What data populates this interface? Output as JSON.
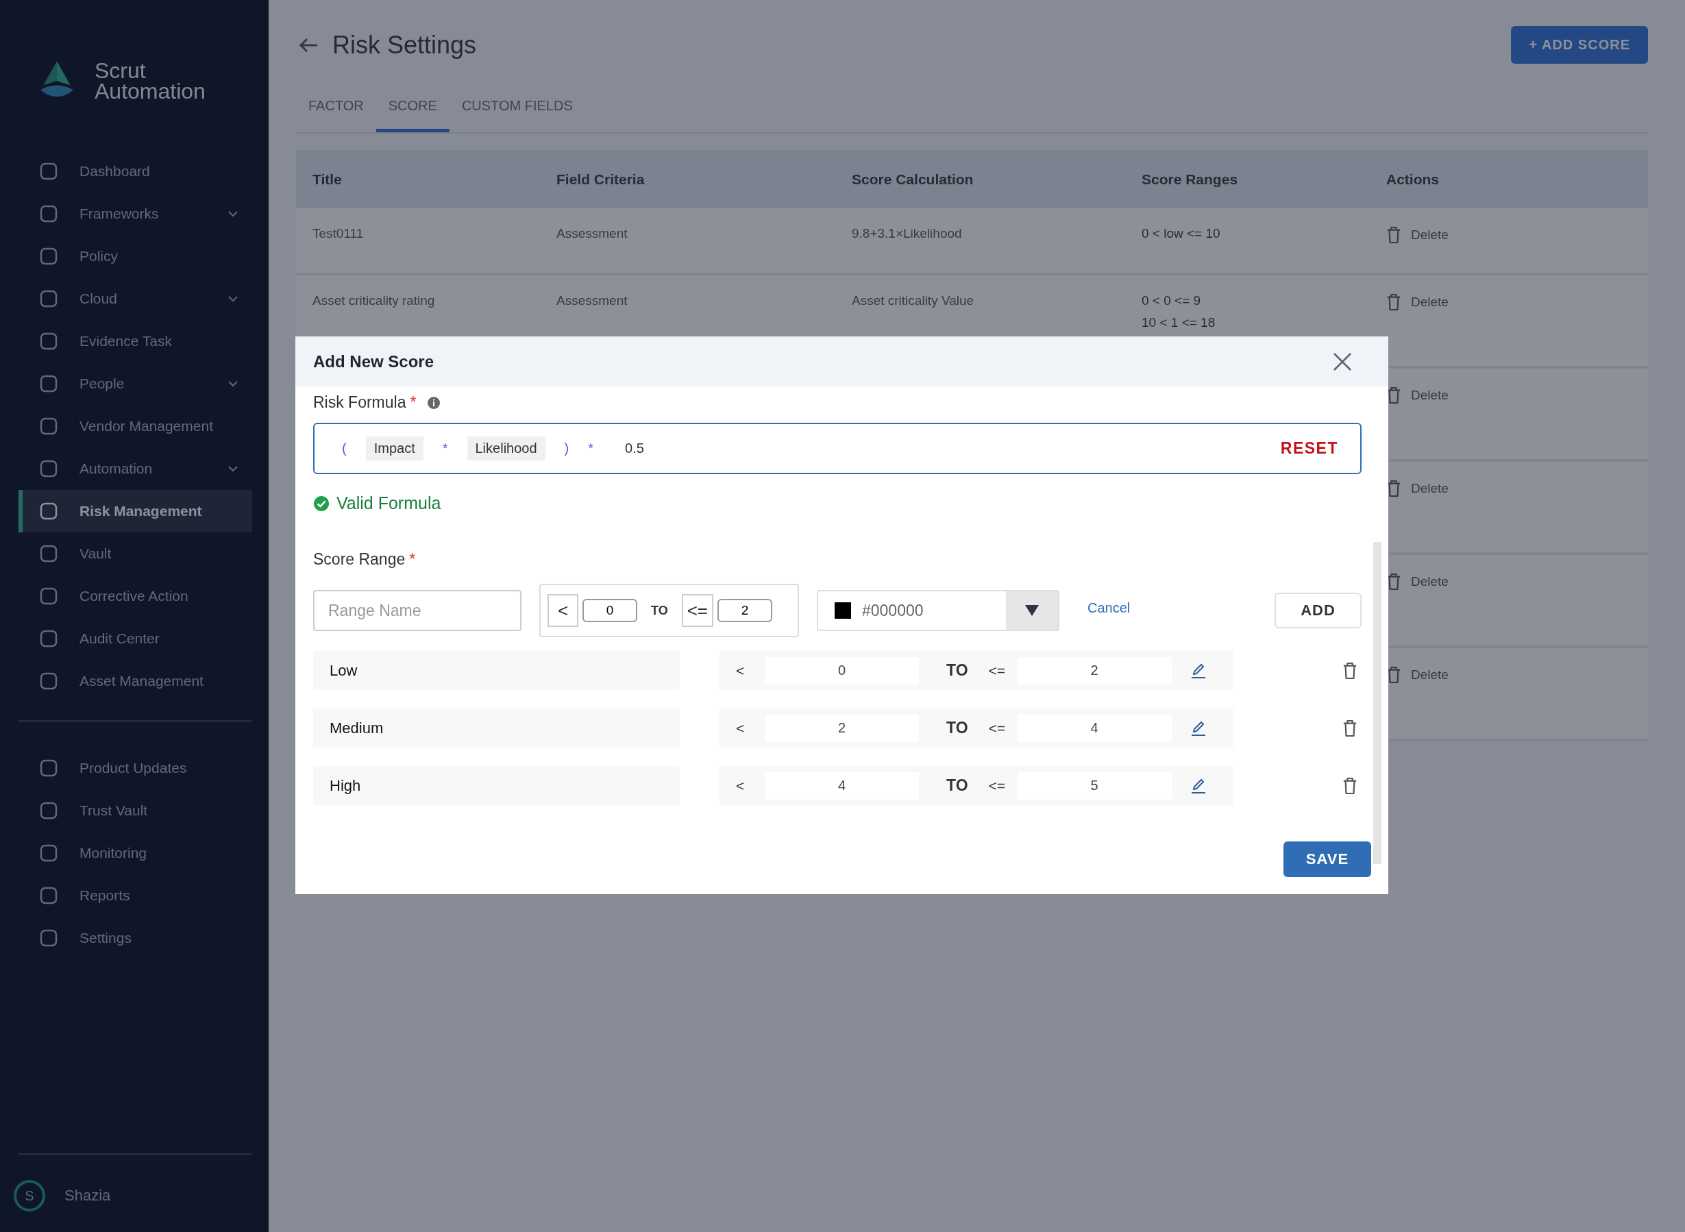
{
  "sidebar": {
    "logo": {
      "line1": "Scrut",
      "line2": "Automation"
    },
    "items": [
      {
        "label": "Dashboard",
        "selected": false,
        "has_submenu": false
      },
      {
        "label": "Frameworks",
        "selected": false,
        "has_submenu": true
      },
      {
        "label": "Policy",
        "selected": false,
        "has_submenu": false
      },
      {
        "label": "Cloud",
        "selected": false,
        "has_submenu": true
      },
      {
        "label": "Evidence Task",
        "selected": false,
        "has_submenu": false
      },
      {
        "label": "People",
        "selected": false,
        "has_submenu": true
      },
      {
        "label": "Vendor Management",
        "selected": false,
        "has_submenu": false
      },
      {
        "label": "Automation",
        "selected": false,
        "has_submenu": true
      },
      {
        "label": "Risk Management",
        "selected": true,
        "has_submenu": false
      },
      {
        "label": "Vault",
        "selected": false,
        "has_submenu": false
      },
      {
        "label": "Corrective Action",
        "selected": false,
        "has_submenu": false
      },
      {
        "label": "Audit Center",
        "selected": false,
        "has_submenu": false
      },
      {
        "label": "Asset Management",
        "selected": false,
        "has_submenu": false
      }
    ],
    "bottom_items": [
      {
        "label": "Product Updates",
        "selected": false
      },
      {
        "label": "Trust Vault",
        "selected": false
      },
      {
        "label": "Monitoring",
        "selected": false
      },
      {
        "label": "Reports",
        "selected": false
      },
      {
        "label": "Settings",
        "selected": false
      }
    ],
    "user": {
      "initial": "S",
      "name": "Shazia"
    }
  },
  "page": {
    "title": "Risk Settings",
    "add_button": "+ ADD SCORE",
    "tabs": [
      {
        "label": "FACTOR",
        "selected": false
      },
      {
        "label": "SCORE",
        "selected": true
      },
      {
        "label": "CUSTOM FIELDS",
        "selected": false
      }
    ],
    "table": {
      "columns": [
        "Title",
        "Field Criteria",
        "Score Calculation",
        "Score Ranges",
        "Actions"
      ],
      "rows": [
        {
          "cells": [
            "Test0111",
            "Assessment",
            "9.8+3.1×Likelihood"
          ],
          "ranges": [
            "0 < low <= 10"
          ],
          "action": "Delete"
        },
        {
          "cells": [
            "Asset criticality rating",
            "Assessment",
            "Asset criticality Value"
          ],
          "ranges": [
            "0 < 0 <= 9",
            "10 < 1 <= 18"
          ],
          "action": "Delete"
        },
        {
          "action": "Delete"
        },
        {
          "action": "Delete"
        },
        {
          "action": "Delete"
        },
        {
          "action": "Delete"
        }
      ]
    }
  },
  "modal": {
    "title": "Add New Score",
    "formula": {
      "label": "Risk Formula",
      "required_mark": "*",
      "tokens": [
        {
          "kind": "paren",
          "text": "("
        },
        {
          "kind": "field",
          "text": "Impact"
        },
        {
          "kind": "operator",
          "text": "*"
        },
        {
          "kind": "field",
          "text": "Likelihood"
        },
        {
          "kind": "paren",
          "text": ")"
        },
        {
          "kind": "operator",
          "text": "*"
        },
        {
          "kind": "number",
          "text": "0.5"
        }
      ],
      "reset": "RESET",
      "status": "Valid Formula"
    },
    "score_range": {
      "label": "Score Range",
      "required_mark": "*",
      "new_range": {
        "name_field": {
          "placeholder": "Range Name"
        },
        "lower_op": "<",
        "lower_value": "0",
        "to": "TO",
        "upper_op": "<=",
        "upper_value": "2",
        "color": "#000000",
        "cancel": "Cancel",
        "add": "ADD"
      },
      "ranges": [
        {
          "name": "Low",
          "lower_op": "<",
          "lower": "0",
          "to": "TO",
          "upper_op": "<=",
          "upper": "2"
        },
        {
          "name": "Medium",
          "lower_op": "<",
          "lower": "2",
          "to": "TO",
          "upper_op": "<=",
          "upper": "4"
        },
        {
          "name": "High",
          "lower_op": "<",
          "lower": "4",
          "to": "TO",
          "upper_op": "<=",
          "upper": "5"
        }
      ]
    },
    "save": "SAVE"
  }
}
